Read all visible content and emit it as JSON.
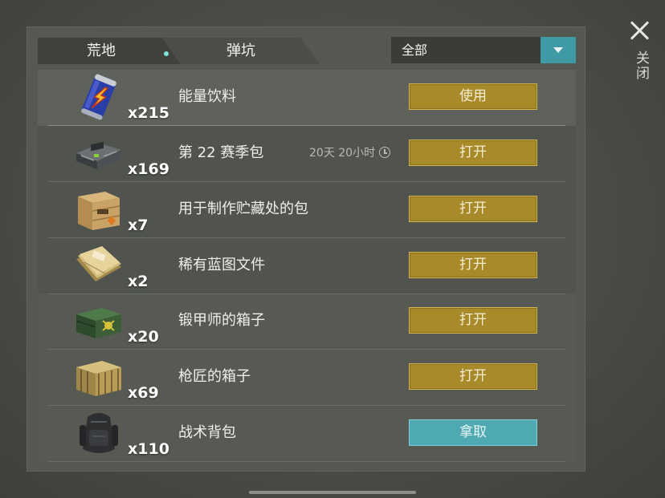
{
  "close": {
    "label": "关闭",
    "icon": "close-icon"
  },
  "tabs": [
    {
      "label": "荒地",
      "active": true,
      "has_notification": true
    },
    {
      "label": "弹坑",
      "active": false
    }
  ],
  "filter": {
    "value": "全部",
    "icon": "chevron-down-icon",
    "accent": "#3f9aa6"
  },
  "items": [
    {
      "name": "能量饮料",
      "quantity": "x215",
      "action": "使用",
      "action_style": "gold",
      "icon": "energy-drink-can-icon"
    },
    {
      "name": "第 22 赛季包",
      "quantity": "x169",
      "timer": "20天 20小时",
      "action": "打开",
      "action_style": "gold",
      "icon": "season-pack-case-icon"
    },
    {
      "name": "用于制作贮藏处的包",
      "quantity": "x7",
      "action": "打开",
      "action_style": "gold",
      "icon": "wooden-crate-icon"
    },
    {
      "name": "稀有蓝图文件",
      "quantity": "x2",
      "action": "打开",
      "action_style": "gold",
      "icon": "blueprint-folder-icon"
    },
    {
      "name": "锻甲师的箱子",
      "quantity": "x20",
      "action": "打开",
      "action_style": "gold",
      "icon": "armorer-box-icon"
    },
    {
      "name": "枪匠的箱子",
      "quantity": "x69",
      "action": "打开",
      "action_style": "gold",
      "icon": "gunsmith-crate-icon"
    },
    {
      "name": "战术背包",
      "quantity": "x110",
      "action": "拿取",
      "action_style": "teal",
      "icon": "tactical-backpack-icon"
    }
  ],
  "colors": {
    "gold_button": "#a98a2a",
    "teal_button": "#4ea9b2",
    "tab_dot": "#7fe2d6"
  }
}
